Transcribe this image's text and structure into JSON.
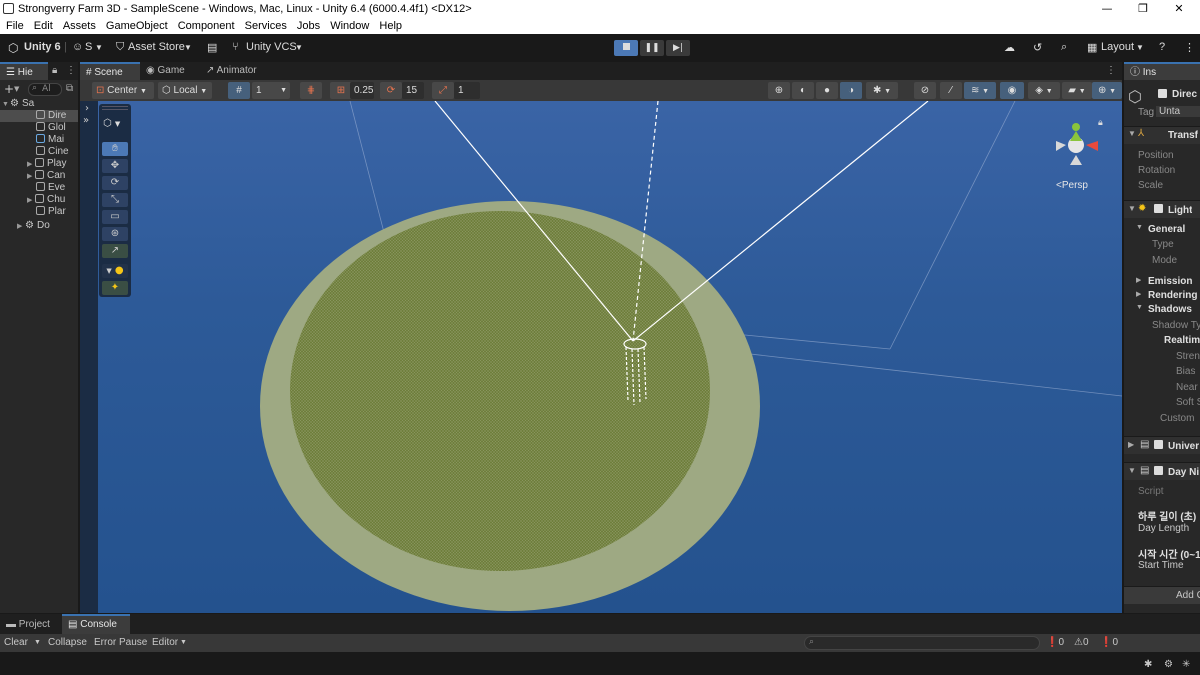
{
  "window": {
    "title": "Strongverry Farm 3D - SampleScene - Windows, Mac, Linux - Unity 6.4 (6000.4.4f1) <DX12>",
    "controls": [
      "—",
      "❐",
      "✕"
    ]
  },
  "menu": [
    "File",
    "Edit",
    "Assets",
    "GameObject",
    "Component",
    "Services",
    "Jobs",
    "Window",
    "Help"
  ],
  "toolbar": {
    "unity_label": "Unity 6",
    "account_label": "S",
    "asset_store": "Asset Store",
    "vcs": "Unity VCS",
    "layout": "Layout"
  },
  "hierarchy": {
    "tab": "Hie",
    "search_placeholder": "Al",
    "rows": [
      {
        "label": "Sa",
        "indent": 0,
        "expanded": true,
        "scene": true
      },
      {
        "label": "Dire",
        "indent": 1,
        "selected": true
      },
      {
        "label": "Glol",
        "indent": 1
      },
      {
        "label": "Mai",
        "indent": 1
      },
      {
        "label": "Cine",
        "indent": 1
      },
      {
        "label": "Play",
        "indent": 1,
        "collapsed": true
      },
      {
        "label": "Can",
        "indent": 1,
        "collapsed": true
      },
      {
        "label": "Eve",
        "indent": 1
      },
      {
        "label": "Chu",
        "indent": 1,
        "collapsed": true
      },
      {
        "label": "Plar",
        "indent": 1
      },
      {
        "label": "Do",
        "indent": 0,
        "collapsed": true,
        "scene": true
      }
    ]
  },
  "scene_tabs": [
    {
      "label": "Scene",
      "active": true
    },
    {
      "label": "Game",
      "active": false
    },
    {
      "label": "Animator",
      "active": false
    }
  ],
  "scene_toolbar": {
    "pivot": "Center",
    "space": "Local",
    "grid_value": "1",
    "snap_move": "0.25",
    "snap_rotate": "15",
    "snap_scale": "1"
  },
  "gizmo": {
    "projection": "Persp"
  },
  "inspector": {
    "tab": "Ins",
    "object_name": "Direc",
    "tag_label": "Tag",
    "tag_value": "Unta",
    "transform": {
      "title": "Transf",
      "fields": [
        "Position",
        "Rotation",
        "Scale"
      ]
    },
    "light": {
      "title": "Light",
      "general": "General",
      "general_fields": [
        "Type",
        "Mode"
      ],
      "emission": "Emission",
      "rendering": "Rendering",
      "shadows": "Shadows",
      "shadow_type": "Shadow Ty",
      "realtime": "Realtime",
      "realtime_fields": [
        "Stren",
        "Bias",
        "Near",
        "Soft S"
      ],
      "custom": "Custom"
    },
    "universal": "Univer",
    "daynight": {
      "title": "Day Ni",
      "script_label": "Script",
      "day_length_kr": "하루 길이 (초)",
      "day_length": "Day Length",
      "start_time_kr": "시작 시간 (0~1",
      "start_time": "Start Time"
    },
    "add_component": "Add C"
  },
  "bottom_tabs": [
    {
      "label": "Project",
      "active": false
    },
    {
      "label": "Console",
      "active": true
    }
  ],
  "console": {
    "clear": "Clear",
    "collapse": "Collapse",
    "error_pause": "Error Pause",
    "editor": "Editor",
    "counts": {
      "errors": "0",
      "warnings": "0",
      "info": "0"
    }
  },
  "colors": {
    "accent": "#3a72b0",
    "sky": "#2d5a98",
    "ground_outer": "#9ea983",
    "ground_inner": "#6f7f3c"
  }
}
